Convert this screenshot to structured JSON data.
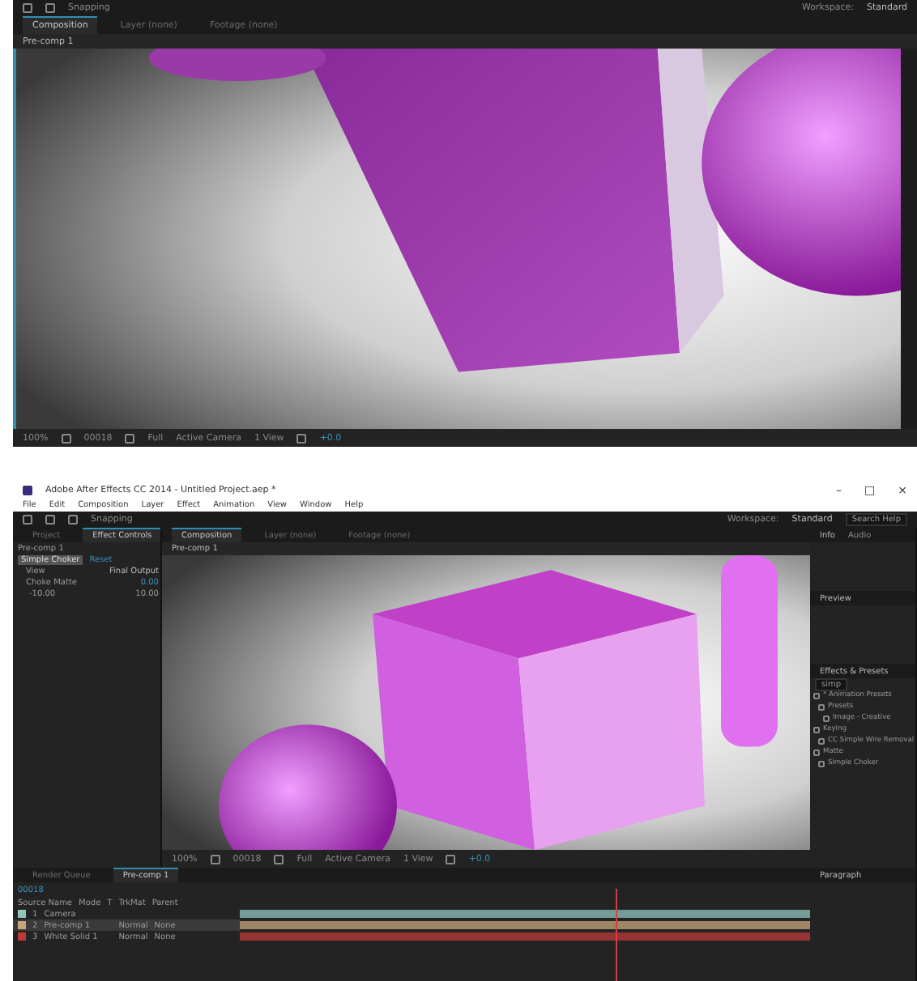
{
  "top_shot": {
    "toolbar": {
      "snapping": "Snapping",
      "workspace_label": "Workspace:",
      "workspace": "Standard"
    },
    "tabs": [
      {
        "label": "Composition",
        "selected": true
      },
      {
        "label": "Layer (none)",
        "selected": false
      },
      {
        "label": "Footage (none)",
        "selected": false
      }
    ],
    "breadcrumb": "Pre-comp 1",
    "viewer_footer": {
      "zoom": "100%",
      "timecode": "00018",
      "resolution": "Full",
      "camera": "Active Camera",
      "views": "1 View",
      "exposure": "+0.0"
    }
  },
  "bottom_shot": {
    "window": {
      "title": "Adobe After Effects CC 2014 - Untitled Project.aep *"
    },
    "window_controls": [
      "–",
      "□",
      "×"
    ],
    "menu": [
      "File",
      "Edit",
      "Composition",
      "Layer",
      "Effect",
      "Animation",
      "View",
      "Window",
      "Help"
    ],
    "toolbar": {
      "snapping": "Snapping",
      "workspace_label": "Workspace:",
      "workspace": "Standard",
      "search_placeholder": "Search Help"
    },
    "effect_controls": {
      "tabs": [
        {
          "label": "Project",
          "selected": false
        },
        {
          "label": "Effect Controls",
          "selected": true
        }
      ],
      "layer": "Pre-comp 1",
      "effect": "Simple Choker",
      "reset": "Reset",
      "params": [
        {
          "name": "View",
          "value": "Final Output"
        },
        {
          "name": "Choke Matte",
          "value": "0.00"
        }
      ],
      "range_min": "-10.00",
      "range_max": "10.00"
    },
    "tabs": [
      {
        "label": "Composition",
        "selected": true
      },
      {
        "label": "Layer (none)",
        "selected": false
      },
      {
        "label": "Footage (none)",
        "selected": false
      }
    ],
    "breadcrumb": "Pre-comp 1",
    "viewer_footer": {
      "zoom": "100%",
      "timecode": "00018",
      "resolution": "Full",
      "camera": "Active Camera",
      "views": "1 View",
      "exposure": "+0.0"
    },
    "side_panels": [
      {
        "title": "Info",
        "tab2": "Audio"
      },
      {
        "title": "Preview"
      },
      {
        "title": "Effects & Presets",
        "search": "simp"
      }
    ],
    "presets": [
      {
        "label": "* Animation Presets",
        "children": [
          {
            "label": "Presets",
            "children": [
              {
                "label": "Image - Creative"
              }
            ]
          }
        ]
      },
      {
        "label": "Keying",
        "children": [
          {
            "label": "CC Simple Wire Removal"
          }
        ]
      },
      {
        "label": "Matte",
        "children": [
          {
            "label": "Simple Choker"
          }
        ]
      }
    ],
    "timeline": {
      "tabs": [
        {
          "label": "Render Queue",
          "selected": false
        },
        {
          "label": "Pre-comp 1",
          "selected": true
        }
      ],
      "timecode": "00018",
      "headers": [
        "Source Name",
        "Mode",
        "T",
        "TrkMat",
        "Parent"
      ],
      "layers": [
        {
          "num": "1",
          "name": "Camera",
          "color": "#8fc5bd",
          "selected": false
        },
        {
          "num": "2",
          "name": "Pre-comp 1",
          "color": "#c9a57c",
          "mode": "Normal",
          "parent": "None",
          "selected": true
        },
        {
          "num": "3",
          "name": "White Solid 1",
          "color": "#c0393b",
          "mode": "Normal",
          "parent": "None",
          "selected": false
        }
      ],
      "playhead": {
        "level": 0.66
      }
    },
    "paragraph_panel": {
      "title": "Paragraph"
    }
  }
}
